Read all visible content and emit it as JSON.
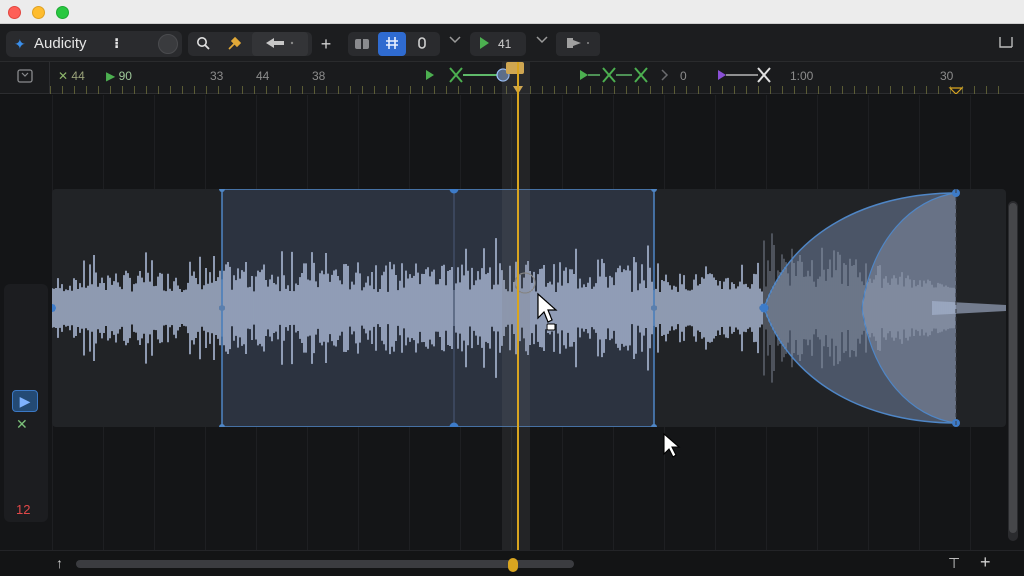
{
  "window": {
    "app_name": "Audicity",
    "app_menu": "⁝"
  },
  "toolbar": {
    "tempo_value": "41",
    "add_label": "+"
  },
  "ruler": {
    "labels": [
      "44",
      "90",
      "33",
      "44",
      "38",
      "0",
      "1:00",
      "30"
    ]
  },
  "track": {
    "gain_label": "12"
  },
  "colors": {
    "accent": "#2f6bd0",
    "playhead": "#d9a520",
    "waveform": "#aab8d4",
    "selection_border": "#4f86c6",
    "gain_negative": "#e04848"
  },
  "icons": [
    "search-icon",
    "pin-icon",
    "arrow-left-icon",
    "plus-icon",
    "snap-icon",
    "grid-icon",
    "record-icon",
    "chevron-down-icon",
    "play-icon",
    "export-icon",
    "sidebar-icon",
    "fade-icon"
  ]
}
